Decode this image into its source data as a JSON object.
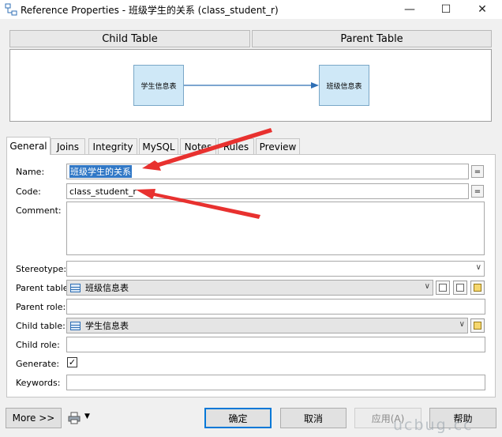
{
  "window": {
    "title": "Reference Properties - 班级学生的关系 (class_student_r)",
    "minimize_glyph": "—",
    "maximize_glyph": "☐",
    "close_glyph": "✕"
  },
  "diagram": {
    "child_header": "Child Table",
    "parent_header": "Parent Table",
    "child_table": "学生信息表",
    "parent_table": "班级信息表"
  },
  "tabs": [
    {
      "label": "General",
      "active": true
    },
    {
      "label": "Joins"
    },
    {
      "label": "Integrity"
    },
    {
      "label": "MySQL"
    },
    {
      "label": "Notes"
    },
    {
      "label": "Rules"
    },
    {
      "label": "Preview"
    }
  ],
  "form": {
    "name_label": "Name:",
    "name_value": "班级学生的关系",
    "code_label": "Code:",
    "code_value": "class_student_r",
    "comment_label": "Comment:",
    "stereotype_label": "Stereotype:",
    "stereotype_value": "",
    "parent_table_label": "Parent table:",
    "parent_table_value": "班级信息表",
    "parent_role_label": "Parent role:",
    "parent_role_value": "",
    "child_table_label": "Child table:",
    "child_table_value": "学生信息表",
    "child_role_label": "Child role:",
    "child_role_value": "",
    "generate_label": "Generate:",
    "generate_checked": true,
    "keywords_label": "Keywords:",
    "keywords_value": "",
    "eq_glyph": "="
  },
  "buttons": {
    "more": "More >>",
    "ok": "确定",
    "cancel": "取消",
    "apply": "应用(A)",
    "help": "帮助"
  },
  "watermark": "ucbug.cc",
  "colors": {
    "annotation_arrow": "#e8312f",
    "selection": "#3178c6",
    "table_box": "#cfe8f7",
    "default_button_border": "#0078d7"
  }
}
